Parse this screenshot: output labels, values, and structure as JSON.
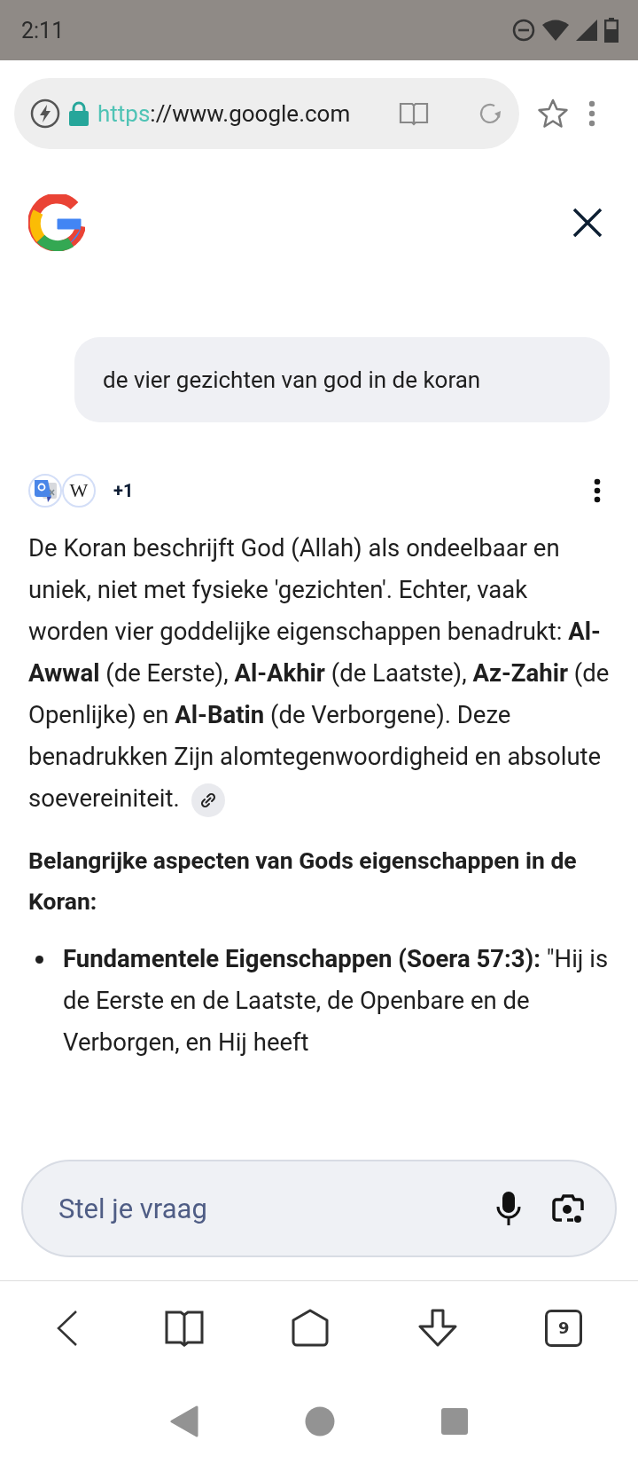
{
  "status_bar": {
    "time": "2:11"
  },
  "address_bar": {
    "scheme": "https",
    "rest": "://www.google.com"
  },
  "query": "de vier gezichten van god in de koran",
  "sources": [
    {
      "kind": "translate"
    },
    {
      "kind": "wikipedia",
      "letter": "W"
    }
  ],
  "sources_more": "+1",
  "answer": {
    "paragraph": "De Koran beschrijft God (Allah) als ondeelbaar en uniek, niet met fysieke 'gezichten'. Echter, vaak worden vier goddelijke eigenschappen benadrukt: **Al-Awwal** (de Eerste), **Al-Akhir** (de Laatste), **Az-Zahir** (de Openlijke) en **Al-Batin** (de Verborgene). Deze benadrukken Zijn alomtegenwoordigheid en absolute soevereiniteit.",
    "heading": "Belangrijke aspecten van Gods eigenschappen in de Koran:",
    "bullets": [
      "**Fundamentele Eigenschappen (Soera 57:3):** \"Hij is de Eerste en de Laatste, de Openbare en de Verborgen, en Hij heeft"
    ]
  },
  "ask_field": {
    "placeholder": "Stel je vraag"
  },
  "toolbar": {
    "tab_count": "9"
  }
}
